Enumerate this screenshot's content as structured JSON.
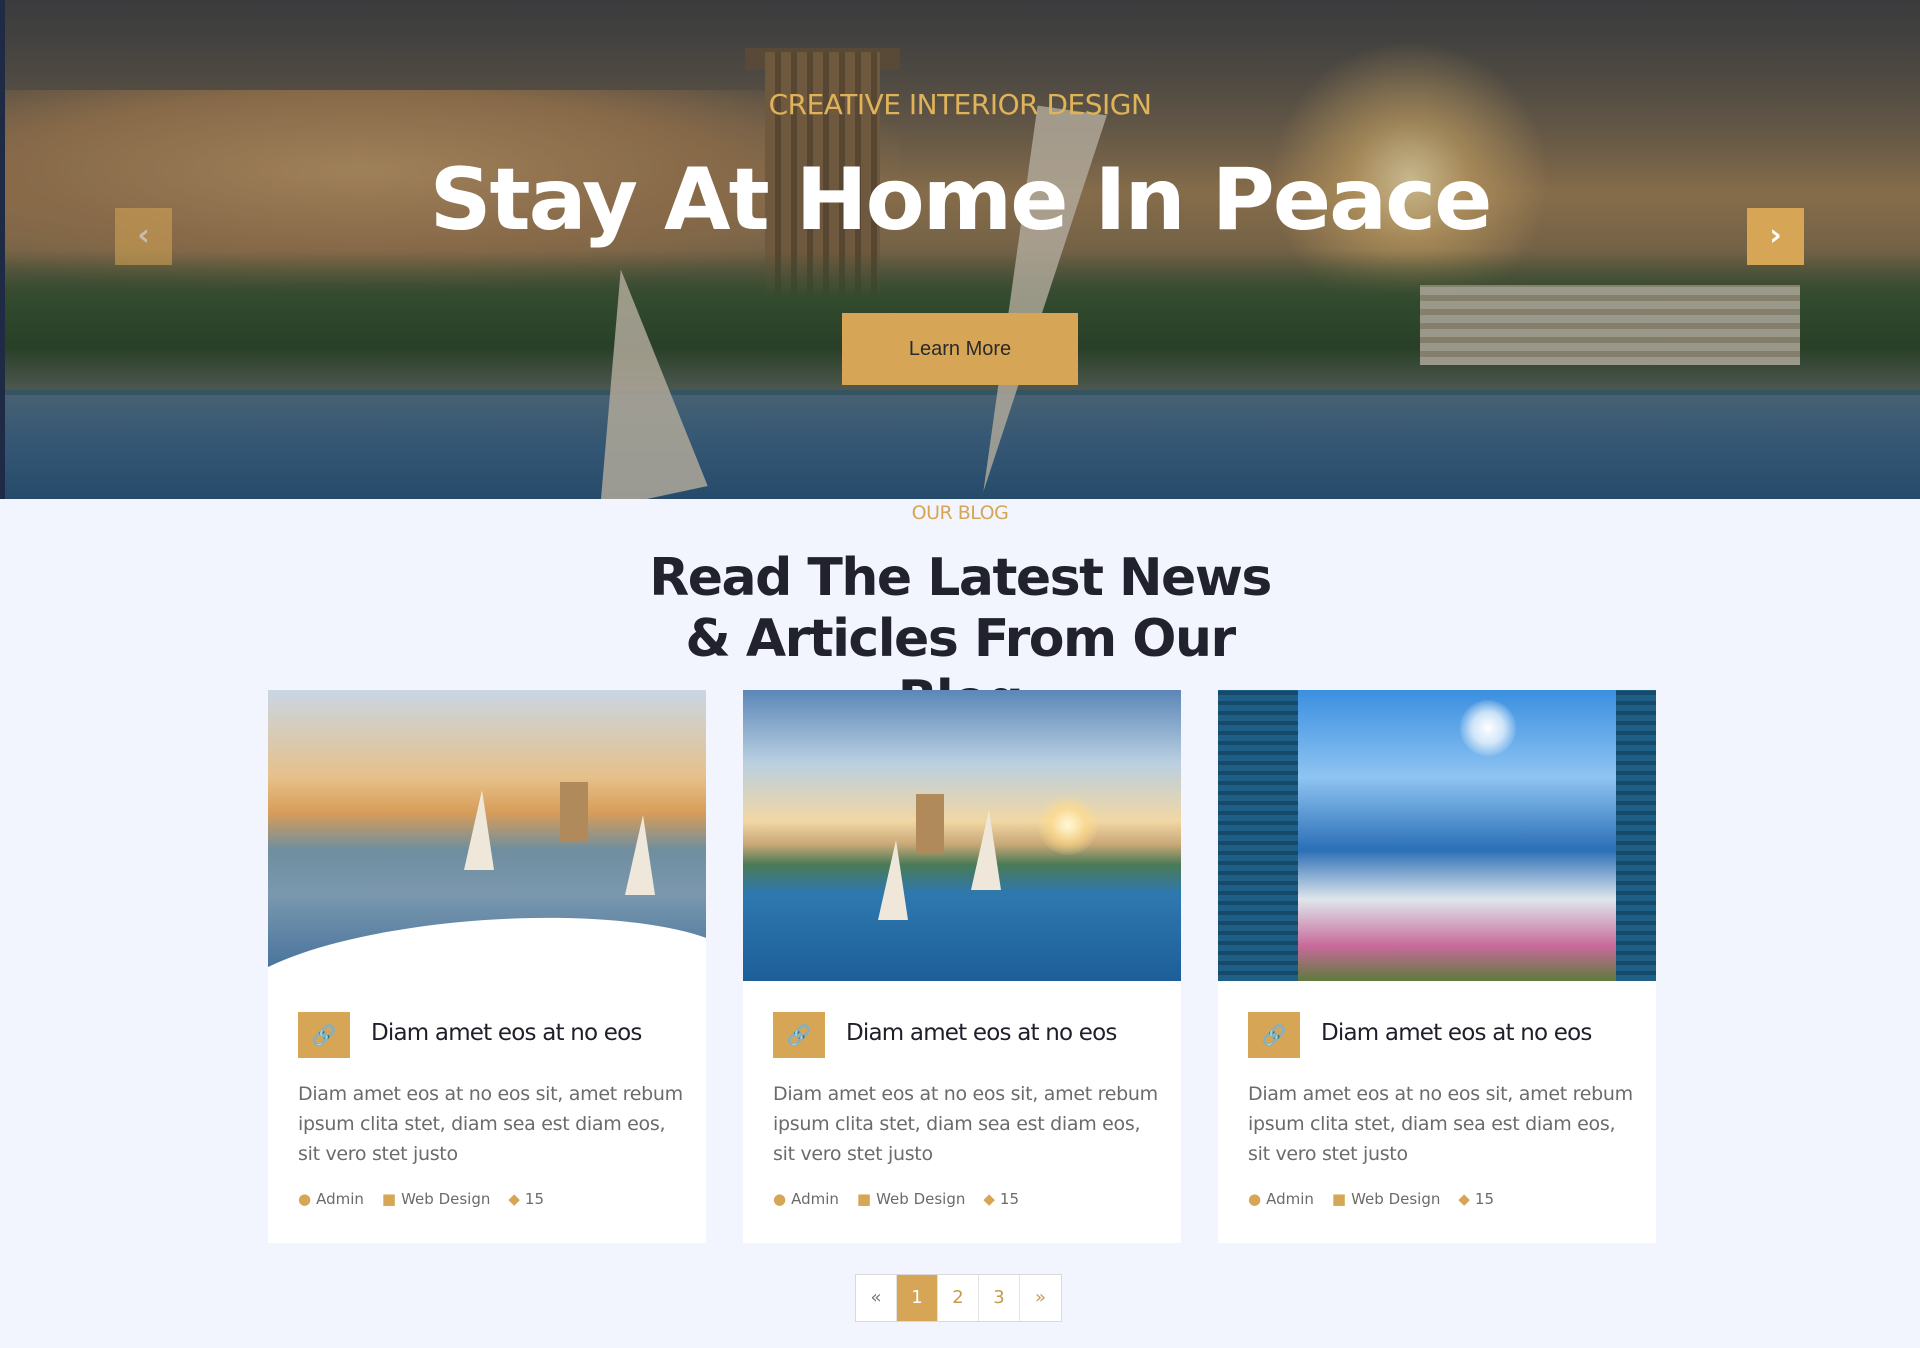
{
  "hero": {
    "subtitle": "CREATIVE INTERIOR DESIGN",
    "title": "Stay At Home In Peace",
    "button_label": "Learn More",
    "prev_arrow": "‹",
    "next_arrow": "›"
  },
  "blog": {
    "label": "OUR BLOG",
    "title": "Read The Latest News & Articles From Our Blog",
    "posts": [
      {
        "title": "Diam amet eos at no eos",
        "excerpt": "Diam amet eos at no eos sit, amet rebum ipsum clita stet, diam sea est diam eos, sit vero stet justo",
        "author": "Admin",
        "category": "Web Design",
        "comments": "15",
        "image_icon": "egypt-sailboats-image"
      },
      {
        "title": "Diam amet eos at no eos",
        "excerpt": "Diam amet eos at no eos sit, amet rebum ipsum clita stet, diam sea est diam eos, sit vero stet justo",
        "author": "Admin",
        "category": "Web Design",
        "comments": "15",
        "image_icon": "nile-sunset-image"
      },
      {
        "title": "Diam amet eos at no eos",
        "excerpt": "Diam amet eos at no eos sit, amet rebum ipsum clita stet, diam sea est diam eos, sit vero stet justo",
        "author": "Admin",
        "category": "Web Design",
        "comments": "15",
        "image_icon": "santorini-window-image"
      }
    ]
  },
  "pagination": {
    "prev": "«",
    "pages": [
      "1",
      "2",
      "3"
    ],
    "active": "1",
    "next": "»"
  },
  "colors": {
    "accent": "#d6a656",
    "background": "#f2f5fd",
    "heading": "#22222e"
  },
  "icons": {
    "link": "link-icon",
    "author": "user-icon",
    "category": "folder-icon",
    "comments": "comments-icon"
  }
}
